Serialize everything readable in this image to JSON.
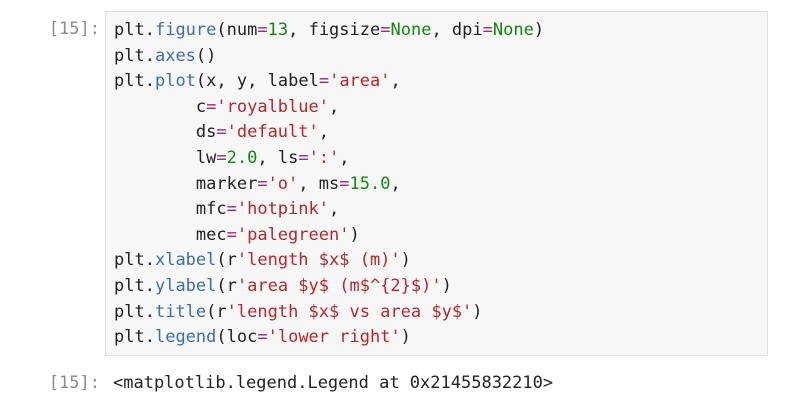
{
  "cell": {
    "input_prompt": "[15]:",
    "output_prompt": "[15]:",
    "output_text": "<matplotlib.legend.Legend at 0x21455832210>",
    "code_lines": [
      [
        [
          "n",
          "plt"
        ],
        [
          "p",
          "."
        ],
        [
          "a",
          "figure"
        ],
        [
          "p",
          "("
        ],
        [
          "n",
          "num"
        ],
        [
          "o",
          "="
        ],
        [
          "m",
          "13"
        ],
        [
          "p",
          ", "
        ],
        [
          "n",
          "figsize"
        ],
        [
          "o",
          "="
        ],
        [
          "k",
          "None"
        ],
        [
          "p",
          ", "
        ],
        [
          "n",
          "dpi"
        ],
        [
          "o",
          "="
        ],
        [
          "k",
          "None"
        ],
        [
          "p",
          ")"
        ]
      ],
      [
        [
          "n",
          "plt"
        ],
        [
          "p",
          "."
        ],
        [
          "a",
          "axes"
        ],
        [
          "p",
          "()"
        ]
      ],
      [
        [
          "n",
          "plt"
        ],
        [
          "p",
          "."
        ],
        [
          "a",
          "plot"
        ],
        [
          "p",
          "("
        ],
        [
          "n",
          "x"
        ],
        [
          "p",
          ", "
        ],
        [
          "n",
          "y"
        ],
        [
          "p",
          ", "
        ],
        [
          "n",
          "label"
        ],
        [
          "o",
          "="
        ],
        [
          "s",
          "'area'"
        ],
        [
          "p",
          ","
        ]
      ],
      [
        [
          "p",
          "        "
        ],
        [
          "n",
          "c"
        ],
        [
          "o",
          "="
        ],
        [
          "s",
          "'royalblue'"
        ],
        [
          "p",
          ","
        ]
      ],
      [
        [
          "p",
          "        "
        ],
        [
          "n",
          "ds"
        ],
        [
          "o",
          "="
        ],
        [
          "s",
          "'default'"
        ],
        [
          "p",
          ","
        ]
      ],
      [
        [
          "p",
          "        "
        ],
        [
          "n",
          "lw"
        ],
        [
          "o",
          "="
        ],
        [
          "m",
          "2.0"
        ],
        [
          "p",
          ", "
        ],
        [
          "n",
          "ls"
        ],
        [
          "o",
          "="
        ],
        [
          "s",
          "':'"
        ],
        [
          "p",
          ","
        ]
      ],
      [
        [
          "p",
          "        "
        ],
        [
          "n",
          "marker"
        ],
        [
          "o",
          "="
        ],
        [
          "s",
          "'o'"
        ],
        [
          "p",
          ", "
        ],
        [
          "n",
          "ms"
        ],
        [
          "o",
          "="
        ],
        [
          "m",
          "15.0"
        ],
        [
          "p",
          ","
        ]
      ],
      [
        [
          "p",
          "        "
        ],
        [
          "n",
          "mfc"
        ],
        [
          "o",
          "="
        ],
        [
          "s",
          "'hotpink'"
        ],
        [
          "p",
          ","
        ]
      ],
      [
        [
          "p",
          "        "
        ],
        [
          "n",
          "mec"
        ],
        [
          "o",
          "="
        ],
        [
          "s",
          "'palegreen'"
        ],
        [
          "p",
          ")"
        ]
      ],
      [
        [
          "n",
          "plt"
        ],
        [
          "p",
          "."
        ],
        [
          "a",
          "xlabel"
        ],
        [
          "p",
          "("
        ],
        [
          "n",
          "r"
        ],
        [
          "s",
          "'length $x$ (m)'"
        ],
        [
          "p",
          ")"
        ]
      ],
      [
        [
          "n",
          "plt"
        ],
        [
          "p",
          "."
        ],
        [
          "a",
          "ylabel"
        ],
        [
          "p",
          "("
        ],
        [
          "n",
          "r"
        ],
        [
          "s",
          "'area $y$ (m$^{2}$)'"
        ],
        [
          "p",
          ")"
        ]
      ],
      [
        [
          "n",
          "plt"
        ],
        [
          "p",
          "."
        ],
        [
          "a",
          "title"
        ],
        [
          "p",
          "("
        ],
        [
          "n",
          "r"
        ],
        [
          "s",
          "'length $x$ vs area $y$'"
        ],
        [
          "p",
          ")"
        ]
      ],
      [
        [
          "n",
          "plt"
        ],
        [
          "p",
          "."
        ],
        [
          "a",
          "legend"
        ],
        [
          "p",
          "("
        ],
        [
          "n",
          "loc"
        ],
        [
          "o",
          "="
        ],
        [
          "s",
          "'lower right'"
        ],
        [
          "p",
          ")"
        ]
      ]
    ]
  },
  "colors": {
    "background": "#ffffff",
    "cell_background": "#f7f7f7",
    "cell_border": "#dedede",
    "prompt": "#8a8a8a",
    "text": "#222222",
    "attribute": "#3c6cb0",
    "operator": "#a2227a",
    "number": "#118811",
    "keyword": "#118811",
    "string": "#b5272b"
  }
}
